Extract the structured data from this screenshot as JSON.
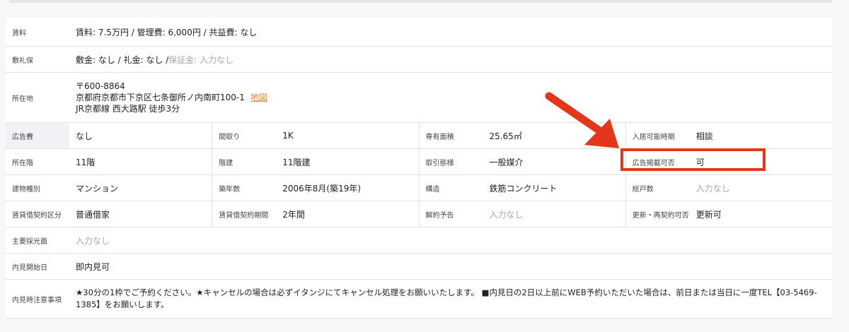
{
  "rent": {
    "label": "賃料",
    "value": "賃料: 7.5万円 / 管理費: 6,000円 / 共益費: なし"
  },
  "deposit": {
    "label": "敷礼保",
    "value_main": "敷金: なし / 礼金: なし / ",
    "value_muted": "保証金: 入力なし"
  },
  "location": {
    "label": "所在地",
    "postal": "〒600-8864",
    "address": "京都府京都市下京区七条御所ノ内南町100-1",
    "map_link": "地図",
    "station": "JR京都線 西大路駅 徒歩3分"
  },
  "grid": [
    [
      {
        "label": "広告費",
        "value": "なし",
        "empty": false
      },
      {
        "label": "間取り",
        "value": "1K",
        "empty": false
      },
      {
        "label": "専有面積",
        "value": "25.65㎡",
        "empty": false
      },
      {
        "label": "入居可能時期",
        "value": "相談",
        "empty": false
      }
    ],
    [
      {
        "label": "所在階",
        "value": "11階",
        "empty": false
      },
      {
        "label": "階建",
        "value": "11階建",
        "empty": false
      },
      {
        "label": "取引態様",
        "value": "一般媒介",
        "empty": false
      },
      {
        "label": "広告掲載可否",
        "value": "可",
        "empty": false
      }
    ],
    [
      {
        "label": "建物種別",
        "value": "マンション",
        "empty": false
      },
      {
        "label": "築年数",
        "value": "2006年8月(築19年)",
        "empty": false
      },
      {
        "label": "構造",
        "value": "鉄筋コンクリート",
        "empty": false
      },
      {
        "label": "総戸数",
        "value": "入力なし",
        "empty": true
      }
    ],
    [
      {
        "label": "賃貸借契約区分",
        "value": "普通借家",
        "empty": false
      },
      {
        "label": "賃貸借契約期間",
        "value": "2年間",
        "empty": false
      },
      {
        "label": "解約予告",
        "value": "入力なし",
        "empty": true
      },
      {
        "label": "更新・再契約可否",
        "value": "更新可",
        "empty": false
      }
    ]
  ],
  "lighting": {
    "label": "主要採光面",
    "value": "入力なし"
  },
  "viewing_start": {
    "label": "内見開始日",
    "value": "即内見可"
  },
  "viewing_notes": {
    "label": "内見時注意事項",
    "value": "★30分の1枠でご予約ください。★キャンセルの場合は必ずイタンジにてキャンセル処理をお願いいたします。 ■内見日の2日以上前にWEB予約いただいた場合は、前日または当日に一度TEL【03-5469-1385】をお願いします。"
  },
  "annotation": {
    "color": "#e4361b"
  }
}
